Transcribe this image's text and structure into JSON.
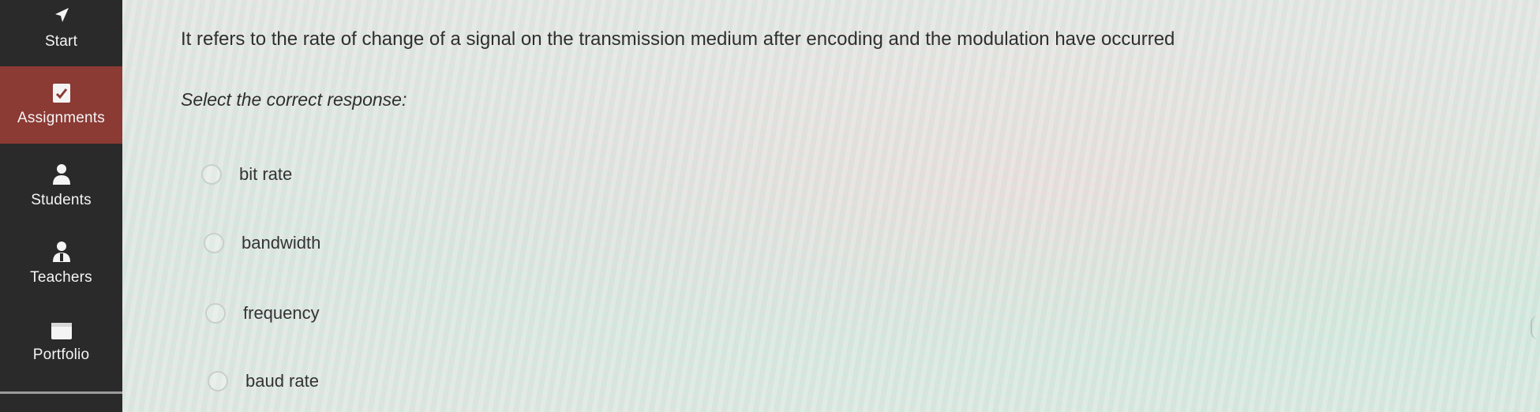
{
  "sidebar": {
    "items": [
      {
        "label": "Start",
        "icon": "start-arrow-icon"
      },
      {
        "label": "Assignments",
        "icon": "assignment-check-icon",
        "active": true
      },
      {
        "label": "Students",
        "icon": "student-person-icon"
      },
      {
        "label": "Teachers",
        "icon": "teacher-person-icon"
      },
      {
        "label": "Portfolio",
        "icon": "portfolio-folder-icon"
      }
    ]
  },
  "question": {
    "text": "It refers to the rate of change of a signal on the transmission medium after encoding and the modulation have occurred",
    "prompt": "Select the correct response:"
  },
  "options": [
    {
      "label": "bit rate"
    },
    {
      "label": "bandwidth"
    },
    {
      "label": "frequency"
    },
    {
      "label": "baud rate"
    }
  ],
  "colors": {
    "sidebar": "#2a2a2a",
    "active_nav": "#8b3a34",
    "text": "#2f2f2f"
  }
}
